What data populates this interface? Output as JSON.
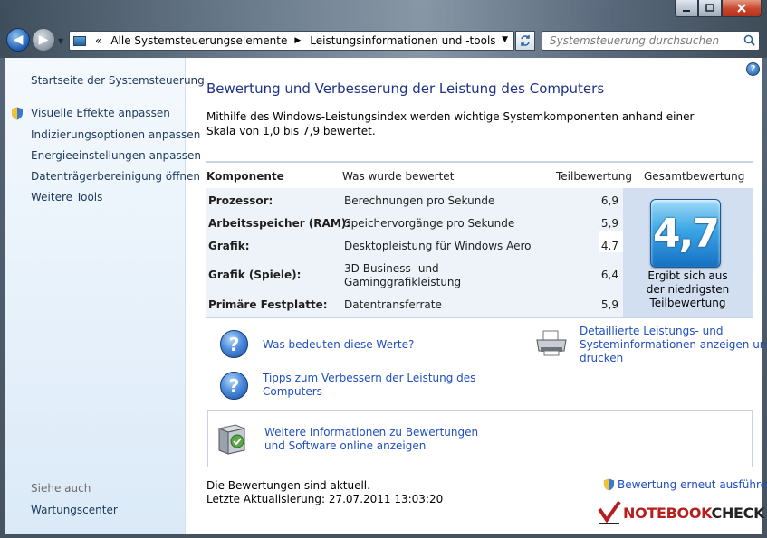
{
  "address_bar": {
    "overflow": "«",
    "segments": [
      "Alle Systemsteuerungselemente",
      "Leistungsinformationen und -tools"
    ]
  },
  "search": {
    "placeholder": "Systemsteuerung durchsuchen"
  },
  "sidebar": {
    "home": "Startseite der Systemsteuerung",
    "items": [
      {
        "label": "Visuelle Effekte anpassen",
        "shield": true
      },
      {
        "label": "Indizierungsoptionen anpassen"
      },
      {
        "label": "Energieeinstellungen anpassen"
      },
      {
        "label": "Datenträgerbereinigung öffnen"
      },
      {
        "label": "Weitere Tools"
      }
    ],
    "see_also_heading": "Siehe auch",
    "see_also_link": "Wartungscenter"
  },
  "main": {
    "title": "Bewertung und Verbesserung der Leistung des Computers",
    "intro": "Mithilfe des Windows-Leistungsindex werden wichtige Systemkomponenten anhand einer Skala von 1,0 bis 7,9 bewertet.",
    "table": {
      "headers": [
        "Komponente",
        "Was wurde bewertet",
        "Teilbewertung",
        "Gesamtbewertung"
      ],
      "rows": [
        {
          "component": "Prozessor:",
          "rated": "Berechnungen pro Sekunde",
          "score": "6,9"
        },
        {
          "component": "Arbeitsspeicher (RAM):",
          "rated": "Speichervorgänge pro Sekunde",
          "score": "5,9"
        },
        {
          "component": "Grafik:",
          "rated": "Desktopleistung für Windows Aero",
          "score": "4,7"
        },
        {
          "component": "Grafik (Spiele):",
          "rated_line1": "3D-Business- und",
          "rated_line2": "Gaminggrafikleistung",
          "score": "6,4"
        },
        {
          "component": "Primäre Festplatte:",
          "rated": "Datentransferrate",
          "score": "5,9"
        }
      ],
      "base_score": "4,7",
      "base_caption": [
        "Ergibt sich aus",
        "der niedrigsten",
        "Teilbewertung"
      ]
    },
    "links": {
      "what_mean": "Was bedeuten diese Werte?",
      "tips_line1": "Tipps zum Verbessern der Leistung des",
      "tips_line2": "Computers",
      "details_line1": "Detaillierte Leistungs- und",
      "details_line2": "Systeminformationen anzeigen und",
      "details_line3": "drucken",
      "online_line1": "Weitere Informationen zu Bewertungen",
      "online_line2": "und Software online anzeigen"
    },
    "status_line1": "Die Bewertungen sind aktuell.",
    "status_line2": "Letzte Aktualisierung: 27.07.2011 13:03:20",
    "rerun": "Bewertung erneut ausführen"
  },
  "watermark": {
    "part1": "NOTEBOOK",
    "part2": "CHECK"
  },
  "colors": {
    "link": "#1f4fbf",
    "title": "#1e3287",
    "score_badge": "#3ba6e5",
    "sidebar_bg": "#dbeaf8"
  }
}
